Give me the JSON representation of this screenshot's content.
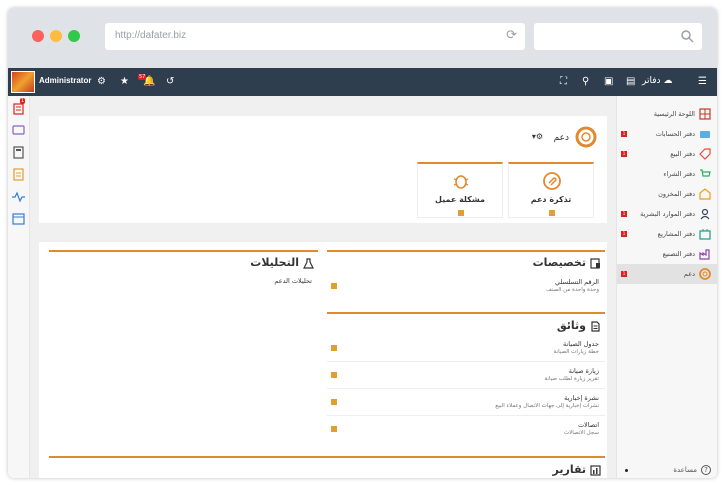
{
  "browser": {
    "url": "http://dafater.biz"
  },
  "topbar": {
    "username": "Administrator",
    "notification_count": "57",
    "brand": "دفاتر"
  },
  "leftbar": {
    "first_badge": "1"
  },
  "sidebar": {
    "items": [
      {
        "label": "اللوحة الرئيسية",
        "icon": "grid-icon",
        "badge": ""
      },
      {
        "label": "دفتر الحسابات",
        "icon": "accounts-icon",
        "badge": "1"
      },
      {
        "label": "دفتر البيع",
        "icon": "tag-icon",
        "badge": "1"
      },
      {
        "label": "دفتر الشراء",
        "icon": "cart-icon",
        "badge": ""
      },
      {
        "label": "دفتر المخزون",
        "icon": "warehouse-icon",
        "badge": ""
      },
      {
        "label": "دفتر الموارد البشرية",
        "icon": "people-icon",
        "badge": "1"
      },
      {
        "label": "دفتر المشاريع",
        "icon": "projects-icon",
        "badge": "1"
      },
      {
        "label": "دفتر التصنيع",
        "icon": "factory-icon",
        "badge": ""
      },
      {
        "label": "دعم",
        "icon": "lifebuoy-icon",
        "badge": "1"
      }
    ],
    "help_label": "مساعدة"
  },
  "page": {
    "title": "دعم"
  },
  "tiles": [
    {
      "label": "تذكرة دعم",
      "icon": "paperclip-icon"
    },
    {
      "label": "مشكلة عميل",
      "icon": "bug-icon"
    }
  ],
  "sections": {
    "assignments": {
      "title": "تخصيصات",
      "rows": [
        {
          "title": "الرقم التسلسلي",
          "desc": "وحدة واحدة من الصنف"
        }
      ]
    },
    "analytics": {
      "title": "التحليلات",
      "rows": [
        {
          "title": "تحليلات الدعم",
          "desc": ""
        }
      ]
    },
    "documents": {
      "title": "وثائق",
      "rows": [
        {
          "title": "جدول الصيانة",
          "desc": "خطة زيارات الصيانة"
        },
        {
          "title": "زيارة صيانة",
          "desc": "تقرير زيارة لطلب صيانة"
        },
        {
          "title": "نشرة إخبارية",
          "desc": "نشرات إخبارية إلى جهات الاتصال وعملاء البيع"
        },
        {
          "title": "اتصالات",
          "desc": "سجل الاتصالات"
        }
      ]
    },
    "reports": {
      "title": "تقارير"
    }
  },
  "colors": {
    "accent": "#e08a30",
    "topbar": "#2e3e4e",
    "badge": "#e02020"
  }
}
